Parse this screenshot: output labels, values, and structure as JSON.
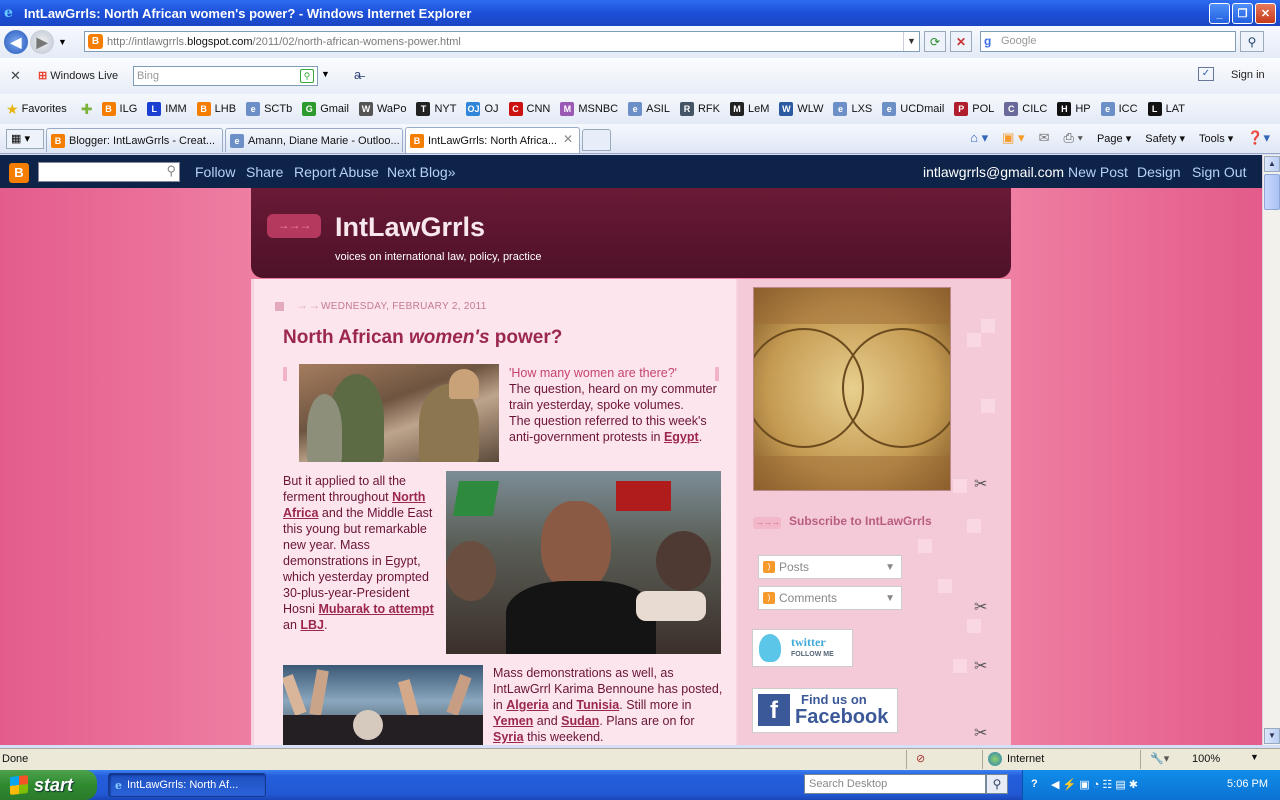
{
  "window": {
    "title": "IntLawGrrls: North African women's power? - Windows Internet Explorer",
    "controls": [
      "_",
      "❐",
      "✕"
    ]
  },
  "address_bar": {
    "url_prefix": "http://intlawgrrls.",
    "url_domain": "blogspot.com",
    "url_path": "/2011/02/north-african-womens-power.html",
    "search_placeholder": "Google"
  },
  "live_bar": {
    "close": "✕",
    "label": "Windows Live",
    "search_placeholder": "Bing",
    "sign_in": "Sign in"
  },
  "favorites": {
    "label": "Favorites",
    "items": [
      {
        "label": "ILG",
        "icon": "B",
        "color": "#f57d00"
      },
      {
        "label": "IMM",
        "icon": "L",
        "color": "#1a3fd1"
      },
      {
        "label": "LHB",
        "icon": "B",
        "color": "#f57d00"
      },
      {
        "label": "SCTb",
        "icon": "e",
        "color": "#6c8fc7"
      },
      {
        "label": "Gmail",
        "icon": "G",
        "color": "#2d9a2d"
      },
      {
        "label": "WaPo",
        "icon": "W",
        "color": "#555555"
      },
      {
        "label": "NYT",
        "icon": "T",
        "color": "#222222"
      },
      {
        "label": "OJ",
        "icon": "OJ",
        "color": "#2f85d8"
      },
      {
        "label": "CNN",
        "icon": "C",
        "color": "#cc1111"
      },
      {
        "label": "MSNBC",
        "icon": "M",
        "color": "#9b59b6"
      },
      {
        "label": "ASIL",
        "icon": "e",
        "color": "#6c8fc7"
      },
      {
        "label": "RFK",
        "icon": "R",
        "color": "#445566"
      },
      {
        "label": "LeM",
        "icon": "M",
        "color": "#222222"
      },
      {
        "label": "WLW",
        "icon": "W",
        "color": "#2c5aa0"
      },
      {
        "label": "LXS",
        "icon": "e",
        "color": "#6c8fc7"
      },
      {
        "label": "UCDmail",
        "icon": "e",
        "color": "#6c8fc7"
      },
      {
        "label": "POL",
        "icon": "P",
        "color": "#b01e2e"
      },
      {
        "label": "CILC",
        "icon": "C",
        "color": "#6a6a9a"
      },
      {
        "label": "HP",
        "icon": "H",
        "color": "#111111"
      },
      {
        "label": "ICC",
        "icon": "e",
        "color": "#6c8fc7"
      },
      {
        "label": "LAT",
        "icon": "L",
        "color": "#111111"
      }
    ]
  },
  "tabs": [
    {
      "label": "Blogger: IntLawGrrls - Creat...",
      "icon": "B"
    },
    {
      "label": "Amann, Diane Marie - Outloo...",
      "icon": "e"
    },
    {
      "label": "IntLawGrrls: North Africa...",
      "icon": "B"
    }
  ],
  "command_bar": {
    "page": "Page",
    "safety": "Safety",
    "tools": "Tools"
  },
  "blogger_nav": {
    "follow": "Follow",
    "share": "Share",
    "report_abuse": "Report Abuse",
    "next_blog": "Next Blog»",
    "email": "intlawgrrls@gmail.com",
    "new_post": "New Post",
    "design": "Design",
    "sign_out": "Sign Out"
  },
  "blog": {
    "title": "IntLawGrrls",
    "description": "voices on international law, policy, practice"
  },
  "post": {
    "date": "WEDNESDAY, FEBRUARY 2, 2011",
    "title_a": "North African ",
    "title_b": "women's",
    "title_c": " power?",
    "p1_quote": "'How many women are there?'",
    "p1_text": "The question, heard on my commuter train yesterday, spoke volumes.",
    "p1_text2": "The question referred to this week's anti-government protests in ",
    "p1_link": "Egypt",
    "p2_a": "But it applied to all the ferment throughout ",
    "p2_link1": "North Africa",
    "p2_b": " and the Middle East this young but remarkable new year. Mass demonstrations in Egypt, which yesterday prompted 30-plus-year-President Hosni ",
    "p2_link2": "Mubarak to attempt",
    "p2_c": " an ",
    "p2_link3": "LBJ",
    "p2_d": ".",
    "p3_a": "Mass demonstrations as well, as IntLawGrrl Karima Bennoune has posted, in ",
    "p3_link1": "Algeria",
    "p3_b": " and ",
    "p3_link2": "Tunisia",
    "p3_c": ". Still more in ",
    "p3_link3": "Yemen",
    "p3_d": " and ",
    "p3_link4": "Sudan",
    "p3_e": ". Plans are on for ",
    "p3_link5": "Syria",
    "p3_f": " this weekend."
  },
  "sidebar": {
    "subscribe": "Subscribe to IntLawGrrls",
    "posts": "Posts",
    "comments": "Comments",
    "twitter_line1": "twitter",
    "twitter_line2": "FOLLOW ME",
    "facebook_line1": "Find us on",
    "facebook_line2": "Facebook"
  },
  "status_bar": {
    "text": "Done",
    "zone": "Internet",
    "zoom": "100%"
  },
  "taskbar": {
    "start": "start",
    "window": "IntLawGrrls: North Af...",
    "search_placeholder": "Search Desktop",
    "clock": "5:06 PM"
  }
}
